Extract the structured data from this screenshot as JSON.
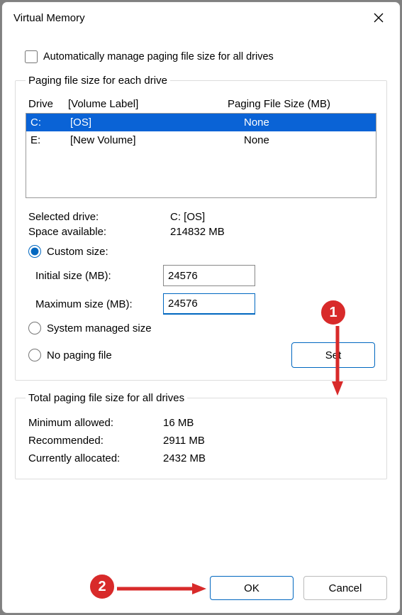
{
  "title": "Virtual Memory",
  "auto_manage_label": "Automatically manage paging file size for all drives",
  "group1": {
    "legend": "Paging file size for each drive",
    "head_drive": "Drive",
    "head_volume": "[Volume Label]",
    "head_size": "Paging File Size (MB)",
    "rows": [
      {
        "drive": "C:",
        "volume": "[OS]",
        "size": "None",
        "selected": true
      },
      {
        "drive": "E:",
        "volume": "[New Volume]",
        "size": "None",
        "selected": false
      }
    ],
    "selected_drive_label": "Selected drive:",
    "selected_drive_value": "C:  [OS]",
    "space_label": "Space available:",
    "space_value": "214832 MB",
    "custom_label": "Custom size:",
    "initial_label": "Initial size (MB):",
    "initial_value": "24576",
    "max_label": "Maximum size (MB):",
    "max_value": "24576",
    "system_label": "System managed size",
    "nopaging_label": "No paging file",
    "set_label": "Set"
  },
  "group2": {
    "legend": "Total paging file size for all drives",
    "min_label": "Minimum allowed:",
    "min_value": "16 MB",
    "rec_label": "Recommended:",
    "rec_value": "2911 MB",
    "cur_label": "Currently allocated:",
    "cur_value": "2432 MB"
  },
  "footer": {
    "ok": "OK",
    "cancel": "Cancel"
  },
  "callouts": {
    "c1": "1",
    "c2": "2"
  }
}
